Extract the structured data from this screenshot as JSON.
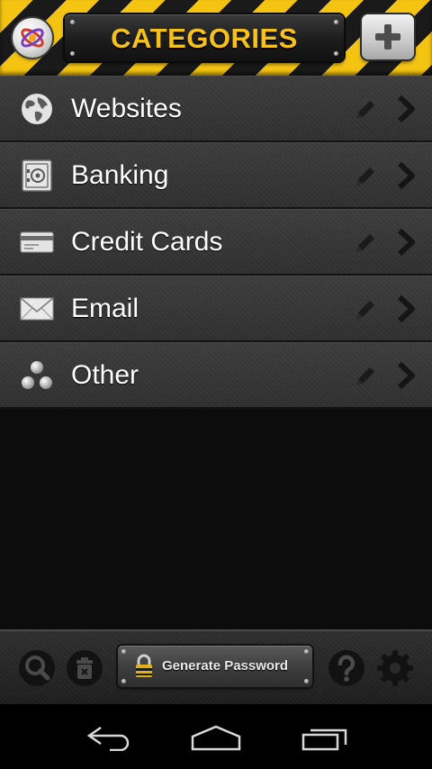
{
  "header": {
    "title": "CATEGORIES",
    "logo_icon": "app-logo-icon",
    "add_icon": "plus-icon"
  },
  "categories": [
    {
      "label": "Websites",
      "icon": "globe-icon"
    },
    {
      "label": "Banking",
      "icon": "safe-icon"
    },
    {
      "label": "Credit Cards",
      "icon": "credit-card-icon"
    },
    {
      "label": "Email",
      "icon": "envelope-icon"
    },
    {
      "label": "Other",
      "icon": "dots-icon"
    }
  ],
  "toolbar": {
    "generate_label": "Generate Password",
    "search_icon": "search-icon",
    "delete_icon": "trash-icon",
    "help_icon": "help-icon",
    "settings_icon": "gear-icon"
  },
  "colors": {
    "accent_yellow": "#f6c11c",
    "stripe_dark": "#1a1a1a",
    "row_bg": "#363636"
  }
}
